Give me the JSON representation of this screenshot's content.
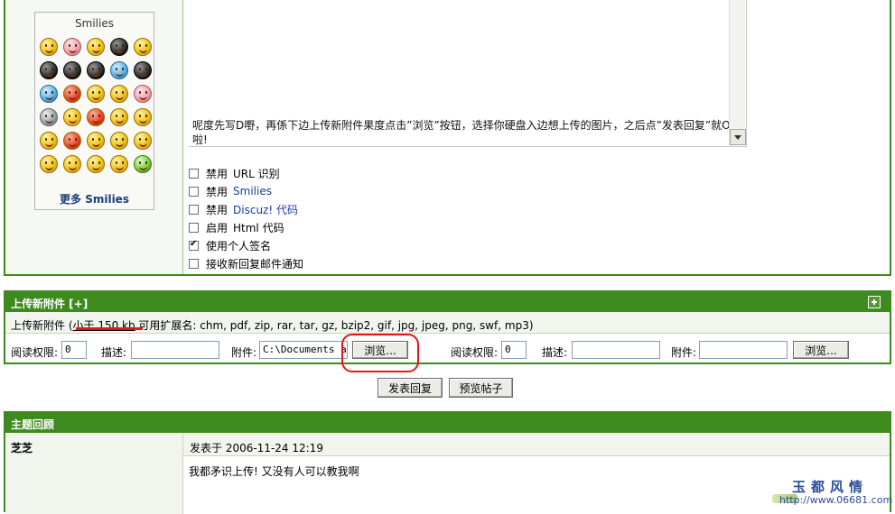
{
  "smilies": {
    "title": "Smilies",
    "more": "更多 Smilies",
    "icons": [
      "smile",
      "cry",
      "shy",
      "angry",
      "laugh",
      "penguin-heart",
      "penguin",
      "penguin-2",
      "music-note",
      "bird",
      "rain-cloud",
      "angry-red",
      "blush",
      "think",
      "pig",
      "snail",
      "handshake",
      "lips",
      "sad",
      "wink",
      "sweat",
      "curse",
      "dizzy",
      "tongue",
      "drool",
      "tongue-out",
      "happy",
      "wail",
      "grin",
      "bonsai"
    ]
  },
  "editor": {
    "text": "呢度先写D嘢，再係下边上传新附件果度点击”浏览”按钮，选择你硬盘入边想上传的图片，之后点”发表回复”就O啦!"
  },
  "options": [
    {
      "prefix": "禁用",
      "label": "URL 识别",
      "checked": false,
      "link": false
    },
    {
      "prefix": "禁用",
      "label": "Smilies",
      "checked": false,
      "link": true
    },
    {
      "prefix": "禁用",
      "label": "Discuz! 代码",
      "checked": false,
      "link": true
    },
    {
      "prefix": "启用",
      "label": "Html 代码",
      "checked": false,
      "link": false
    },
    {
      "prefix": "使用个人签名",
      "label": "",
      "checked": true,
      "link": false
    },
    {
      "prefix": "接收新回复邮件通知",
      "label": "",
      "checked": false,
      "link": false
    }
  ],
  "attach": {
    "title": "上传新附件 [+]",
    "info_prefix": "上传新附件 (",
    "info_limit": "小于 150 kb",
    "info_suffix": " 可用扩展名: chm, pdf, zip, rar, tar, gz, bzip2, gif, jpg, jpeg, png, swf, mp3)",
    "read_perm_label": "阅读权限:",
    "read_perm_value": "0",
    "desc_label": "描述:",
    "desc_value": "",
    "file_label": "附件:",
    "file_value": "C:\\Documents an",
    "browse_label": "浏览...",
    "read_perm_label_2": "阅读权限:",
    "read_perm_value_2": "0",
    "desc_label_2": "描述:",
    "desc_value_2": "",
    "file_label_2": "附件:",
    "file_value_2": "",
    "browse_label_2": "浏览..."
  },
  "actions": {
    "submit_label": "发表回复",
    "preview_label": "预览帖子"
  },
  "review": {
    "title": "主题回顾",
    "author": "芝芝",
    "date": "发表于  2006-11-24 12:19",
    "body": "我都矛识上传! 又没有人可以教我啊"
  },
  "watermark": {
    "title": "玉都风情",
    "url": "http://www.06681.com"
  }
}
